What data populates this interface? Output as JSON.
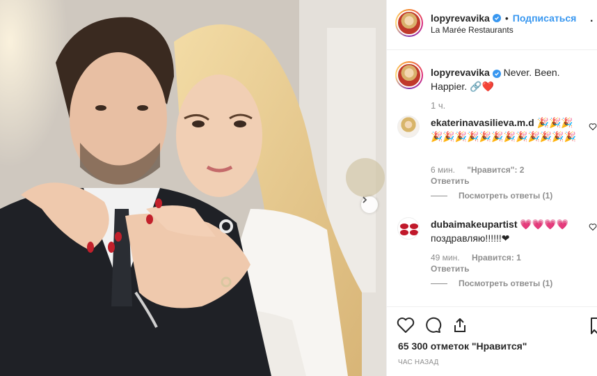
{
  "post": {
    "username": "lopyrevavika",
    "follow_label": "Подписаться",
    "location": "La Marée Restaurants",
    "more_icon": "more-icon"
  },
  "caption": {
    "username": "lopyrevavika",
    "text": "Never. Been. Happier. 🔗❤️",
    "time": "1 ч."
  },
  "comments": [
    {
      "username": "ekaterinavasilieva.m.d",
      "text": "🎉🎉🎉🎉🎉🎉🎉🎉🎉🎉🎉🎉🎉🎉🎉",
      "time": "6 мин.",
      "likes": "\"Нравится\": 2",
      "reply": "Ответить",
      "view_replies": "Посмотреть ответы (1)"
    },
    {
      "username": "dubaimakeupartist",
      "text": "💗💗💗💗 поздравляю!!!!!!❤",
      "time": "49 мин.",
      "likes": "Нравится: 1",
      "reply": "Ответить",
      "view_replies": "Посмотреть ответы (1)"
    }
  ],
  "footer": {
    "likes_count": "65 300 отметок \"Нравится\"",
    "time_ago": "ЧАС НАЗАД"
  },
  "colors": {
    "accent": "#3897f0",
    "like_red": "#ed4956",
    "muted": "#8e8e8e"
  }
}
